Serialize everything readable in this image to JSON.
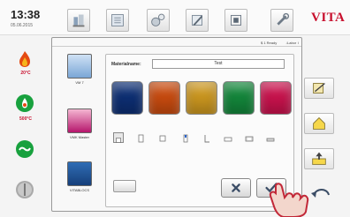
{
  "topbar": {
    "time": "13:38",
    "date": "05.06.2015",
    "tools": [
      "program-tool-icon",
      "program-list-icon",
      "settings-tool-icon",
      "pencil-tool-icon",
      "kiln-tool-icon",
      "tools-icon"
    ],
    "logo": "VITA"
  },
  "status": {
    "temp_top": "20°C",
    "temp_kiln": "500°C"
  },
  "dialog": {
    "header_ready": "$ 1 Ready",
    "header_labor": "↓Labor ↕",
    "materials": [
      {
        "label": "VM 7",
        "icon": "vm7-bottle-icon"
      },
      {
        "label": "VMK Master",
        "icon": "vmk-master-icon"
      },
      {
        "label": "VITABLOCS",
        "icon": "vitablocs-icon"
      }
    ],
    "material_name_label": "Materialname:",
    "material_name_value": "Test",
    "color_swatches": [
      "#0d2e72",
      "#c64a0f",
      "#c9951f",
      "#13853a",
      "#c7124c"
    ],
    "shape_icons": [
      "crown-shape-icon",
      "bridge-shape-icon",
      "inlay-shape-icon",
      "veneer-shape-icon",
      "post-shape-icon",
      "tray-shape-icon",
      "block-shape-icon",
      "plate-shape-icon"
    ]
  },
  "colors": {
    "brand": "#c8102e",
    "accent_green": "#18a13e",
    "temp_red": "#c8102e"
  }
}
